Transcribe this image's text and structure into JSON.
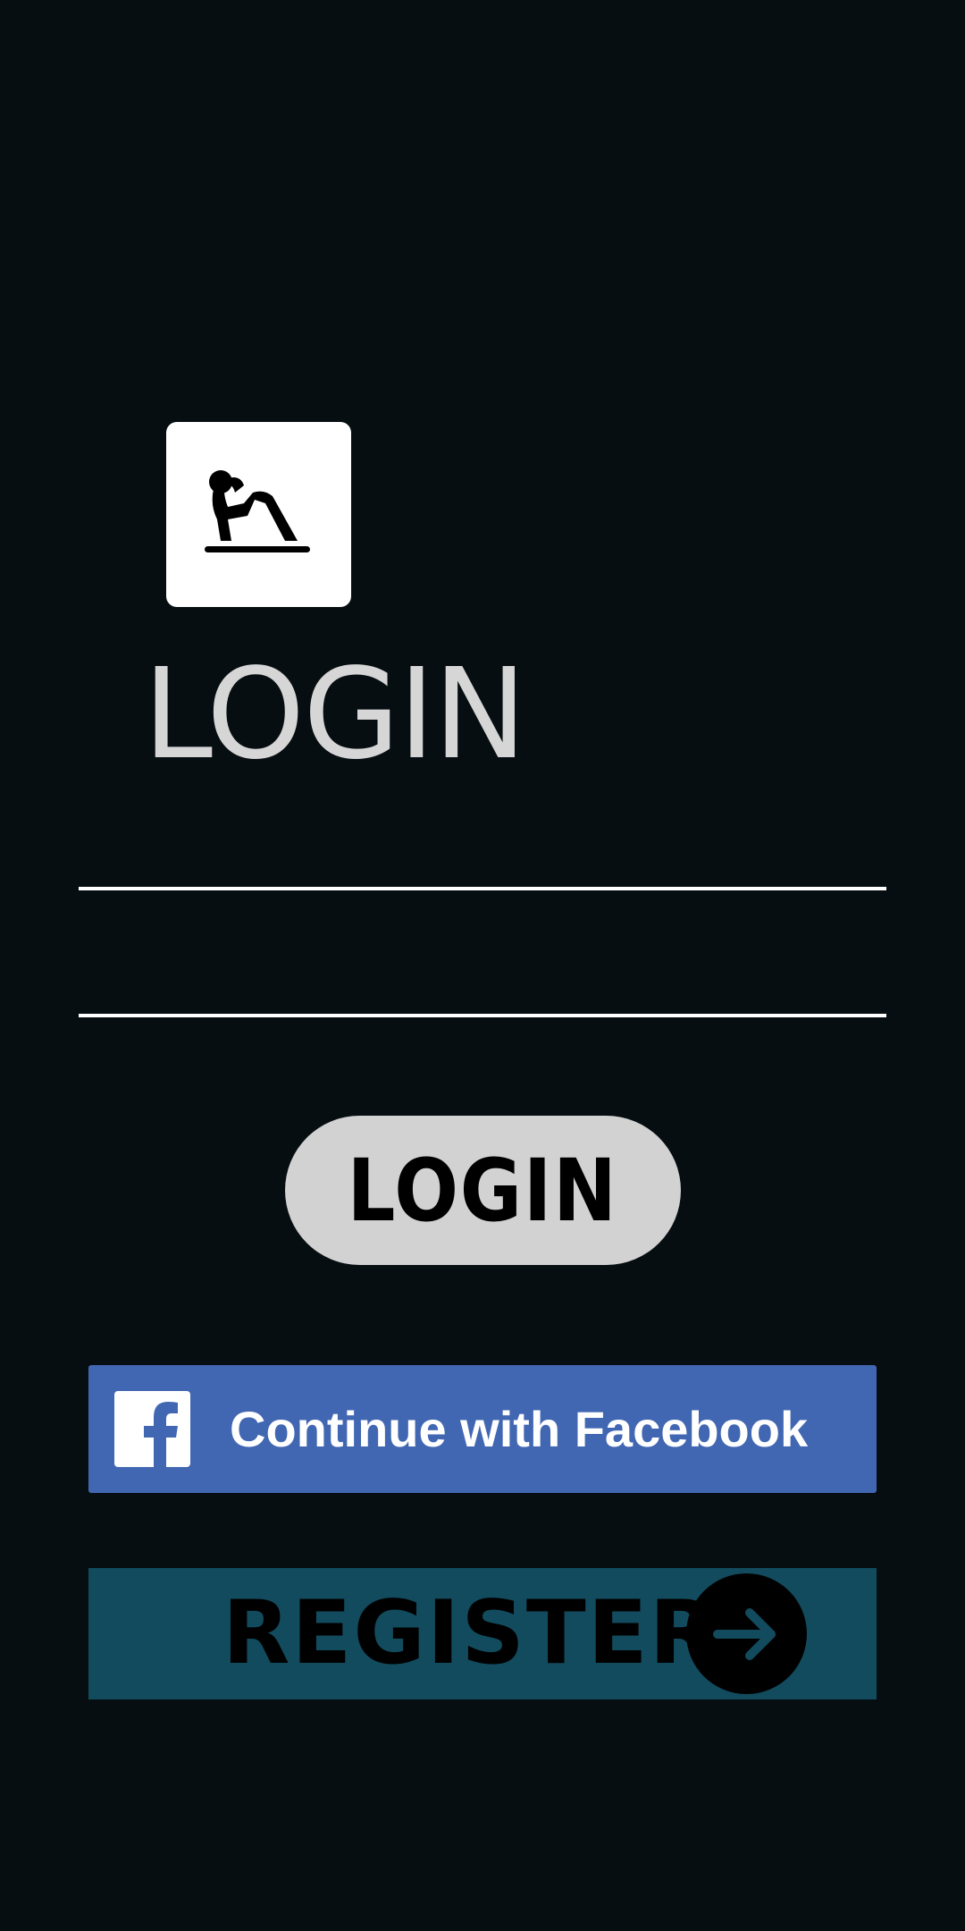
{
  "app": {
    "logo_icon": "situps-exercise-icon"
  },
  "header": {
    "title": "LOGIN"
  },
  "form": {
    "username": {
      "value": "",
      "placeholder": ""
    },
    "password": {
      "value": "",
      "placeholder": ""
    },
    "login_label": "LOGIN"
  },
  "social": {
    "facebook_label": "Continue with Facebook",
    "facebook_icon": "facebook-icon"
  },
  "register": {
    "label": "REGISTER",
    "icon": "arrow-right-icon"
  },
  "colors": {
    "background": "#070e11",
    "title": "#d6d6d6",
    "login_button": "#d2d2d2",
    "facebook": "#4267b2",
    "register": "#124b5e"
  }
}
